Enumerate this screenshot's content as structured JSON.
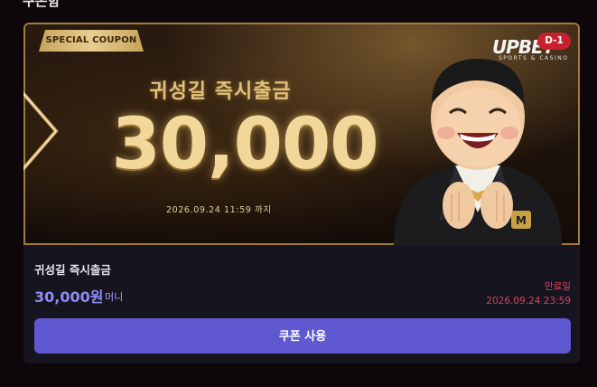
{
  "section": {
    "title": "쿠폰함"
  },
  "banner": {
    "tag": "SPECIAL COUPON",
    "headline": "귀성길 즉시출금",
    "amount": "30,000",
    "until": "2026.09.24 11:59 까지",
    "logo": "UPBET",
    "logo_sub": "SPORTS & CASINO",
    "dday": "D-1"
  },
  "coupon": {
    "title": "귀성길 즉시출금",
    "price": "30,000원",
    "unit": "머니",
    "expiry_label": "만료일",
    "expiry_date": "2026.09.24 23:59",
    "button_label": "쿠폰 사용"
  },
  "colors": {
    "accent": "#6058d0",
    "gold": "#e2c17a",
    "danger": "#d8465c",
    "price": "#8e8cf5"
  },
  "icons": {
    "chevron": "chevron-right-icon",
    "mascot": "mascot-illustration"
  }
}
